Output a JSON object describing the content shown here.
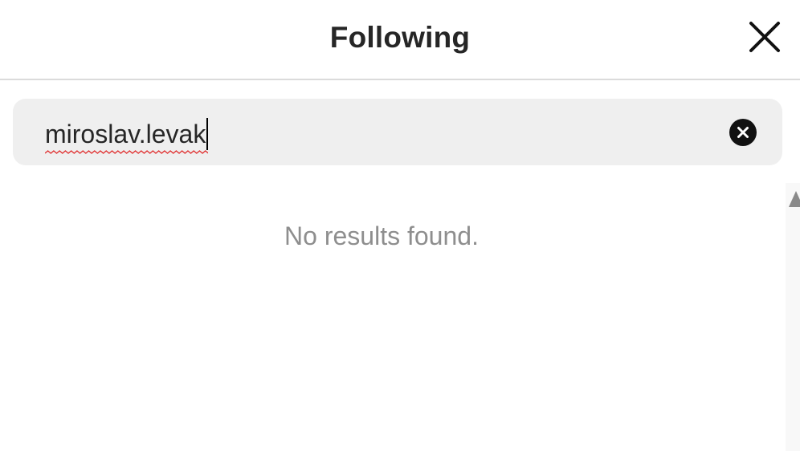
{
  "header": {
    "title": "Following",
    "close_icon": "close-icon"
  },
  "search": {
    "value": "miroslav.levak",
    "clear_icon": "clear-circle-icon"
  },
  "results": {
    "empty_message": "No results found."
  },
  "colors": {
    "background": "#ffffff",
    "search_bg": "#efefef",
    "divider": "#dbdbdb",
    "muted_text": "#8e8e8e",
    "spellcheck": "#e03030"
  }
}
